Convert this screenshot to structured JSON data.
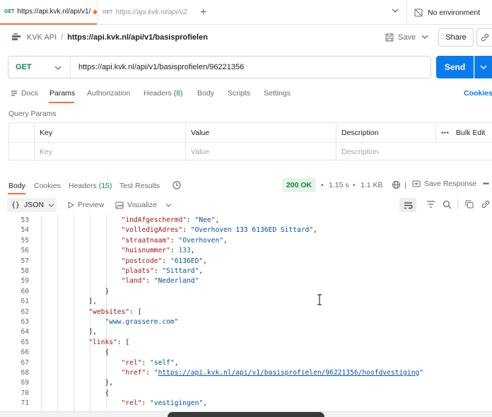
{
  "tabs": [
    {
      "method": "GET",
      "url": "https://api.kvk.nl/api/v1/",
      "unsaved": true
    },
    {
      "method": "GET",
      "url": "https://api.kvk.nl/api/v2/"
    }
  ],
  "environment": {
    "label": "No environment"
  },
  "breadcrumb": {
    "collection": "KVK API",
    "separator": "/",
    "request": "https://api.kvk.nl/api/v1/basisprofielen"
  },
  "header_actions": {
    "save": "Save",
    "share": "Share"
  },
  "request": {
    "method": "GET",
    "url": "https://api.kvk.nl/api/v1/basisprofielen/96221356",
    "send": "Send"
  },
  "request_tabs": {
    "docs": "Docs",
    "params": "Params",
    "authorization": "Authorization",
    "headers": "Headers",
    "headers_count": "(8)",
    "body": "Body",
    "scripts": "Scripts",
    "settings": "Settings",
    "cookies": "Cookies"
  },
  "query_params": {
    "title": "Query Params",
    "columns": {
      "key": "Key",
      "value": "Value",
      "description": "Description",
      "bulk_edit": "Bulk Edit"
    },
    "placeholders": {
      "key": "Key",
      "value": "Value",
      "description": "Description"
    }
  },
  "response": {
    "tabs": {
      "body": "Body",
      "cookies": "Cookies",
      "headers": "Headers",
      "headers_count": "(15)",
      "test_results": "Test Results"
    },
    "status": "200 OK",
    "time": "1.15 s",
    "size": "1.1 KB",
    "save_response": "Save Response",
    "format": "JSON",
    "preview": "Preview",
    "visualize": "Visualize"
  },
  "code_lines": [
    {
      "n": "53",
      "indent": 10,
      "tokens": [
        {
          "t": "\"indAfgeschermd\"",
          "c": "k"
        },
        {
          "t": ": ",
          "c": "p"
        },
        {
          "t": "\"Nee\"",
          "c": "s"
        },
        {
          "t": ",",
          "c": "p"
        }
      ]
    },
    {
      "n": "54",
      "indent": 10,
      "tokens": [
        {
          "t": "\"volledigAdres\"",
          "c": "k"
        },
        {
          "t": ": ",
          "c": "p"
        },
        {
          "t": "\"Overhoven 133 6136ED Sittard\"",
          "c": "s"
        },
        {
          "t": ",",
          "c": "p"
        }
      ]
    },
    {
      "n": "55",
      "indent": 10,
      "tokens": [
        {
          "t": "\"straatnaam\"",
          "c": "k"
        },
        {
          "t": ": ",
          "c": "p"
        },
        {
          "t": "\"Overhoven\"",
          "c": "s"
        },
        {
          "t": ",",
          "c": "p"
        }
      ]
    },
    {
      "n": "56",
      "indent": 10,
      "tokens": [
        {
          "t": "\"huisnummer\"",
          "c": "k"
        },
        {
          "t": ": ",
          "c": "p"
        },
        {
          "t": "133",
          "c": "n"
        },
        {
          "t": ",",
          "c": "p"
        }
      ]
    },
    {
      "n": "57",
      "indent": 10,
      "tokens": [
        {
          "t": "\"postcode\"",
          "c": "k"
        },
        {
          "t": ": ",
          "c": "p"
        },
        {
          "t": "\"6136ED\"",
          "c": "s"
        },
        {
          "t": ",",
          "c": "p"
        }
      ]
    },
    {
      "n": "58",
      "indent": 10,
      "tokens": [
        {
          "t": "\"plaats\"",
          "c": "k"
        },
        {
          "t": ": ",
          "c": "p"
        },
        {
          "t": "\"Sittard\"",
          "c": "s"
        },
        {
          "t": ",",
          "c": "p"
        }
      ]
    },
    {
      "n": "59",
      "indent": 10,
      "tokens": [
        {
          "t": "\"land\"",
          "c": "k"
        },
        {
          "t": ": ",
          "c": "p"
        },
        {
          "t": "\"Nederland\"",
          "c": "s"
        }
      ]
    },
    {
      "n": "60",
      "indent": 8,
      "tokens": [
        {
          "t": "}",
          "c": "p"
        }
      ]
    },
    {
      "n": "61",
      "indent": 6,
      "tokens": [
        {
          "t": "],",
          "c": "p"
        }
      ]
    },
    {
      "n": "62",
      "indent": 6,
      "tokens": [
        {
          "t": "\"websites\"",
          "c": "k"
        },
        {
          "t": ": [",
          "c": "p"
        }
      ]
    },
    {
      "n": "63",
      "indent": 8,
      "tokens": [
        {
          "t": "\"www.grassere.com\"",
          "c": "s"
        }
      ]
    },
    {
      "n": "64",
      "indent": 6,
      "tokens": [
        {
          "t": "],",
          "c": "p"
        }
      ]
    },
    {
      "n": "65",
      "indent": 6,
      "tokens": [
        {
          "t": "\"links\"",
          "c": "k"
        },
        {
          "t": ": [",
          "c": "p"
        }
      ]
    },
    {
      "n": "66",
      "indent": 8,
      "tokens": [
        {
          "t": "{",
          "c": "p"
        }
      ]
    },
    {
      "n": "67",
      "indent": 10,
      "tokens": [
        {
          "t": "\"rel\"",
          "c": "k"
        },
        {
          "t": ": ",
          "c": "p"
        },
        {
          "t": "\"self\"",
          "c": "s"
        },
        {
          "t": ",",
          "c": "p"
        }
      ]
    },
    {
      "n": "68",
      "indent": 10,
      "tokens": [
        {
          "t": "\"href\"",
          "c": "k"
        },
        {
          "t": ": ",
          "c": "p"
        },
        {
          "t": "\"",
          "c": "s"
        },
        {
          "t": "https://api.kvk.nl/api/v1/basisprofielen/96221356/hoofdvestiging",
          "c": "u"
        },
        {
          "t": "\"",
          "c": "s"
        }
      ]
    },
    {
      "n": "69",
      "indent": 8,
      "tokens": [
        {
          "t": "},",
          "c": "p"
        }
      ]
    },
    {
      "n": "70",
      "indent": 8,
      "tokens": [
        {
          "t": "{",
          "c": "p"
        }
      ]
    },
    {
      "n": "71",
      "indent": 10,
      "tokens": [
        {
          "t": "\"rel\"",
          "c": "k"
        },
        {
          "t": ": ",
          "c": "p"
        },
        {
          "t": "\"vestigingen\"",
          "c": "s"
        },
        {
          "t": ",",
          "c": "p"
        }
      ]
    }
  ]
}
